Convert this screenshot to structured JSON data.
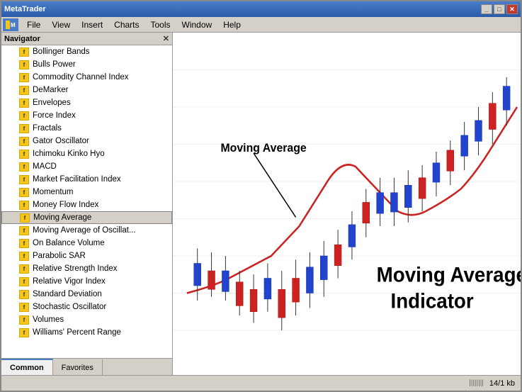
{
  "window": {
    "title": "MetaTrader",
    "title_bar_buttons": [
      "_",
      "□",
      "✕"
    ]
  },
  "menu": {
    "icon_label": "MT",
    "items": [
      "File",
      "View",
      "Insert",
      "Charts",
      "Tools",
      "Window",
      "Help"
    ]
  },
  "navigator": {
    "title": "Navigator",
    "items": [
      "Bollinger Bands",
      "Bulls Power",
      "Commodity Channel Index",
      "DeMarker",
      "Envelopes",
      "Force Index",
      "Fractals",
      "Gator Oscillator",
      "Ichimoku Kinko Hyo",
      "MACD",
      "Market Facilitation Index",
      "Momentum",
      "Money Flow Index",
      "Moving Average",
      "Moving Average of Oscillat...",
      "On Balance Volume",
      "Parabolic SAR",
      "Relative Strength Index",
      "Relative Vigor Index",
      "Standard Deviation",
      "Stochastic Oscillator",
      "Volumes",
      "Williams' Percent Range"
    ],
    "selected_index": 13,
    "tabs": [
      "Common",
      "Favorites"
    ]
  },
  "chart": {
    "moving_average_label": "Moving Average",
    "indicator_label_line1": "Moving Average",
    "indicator_label_line2": "Indicator",
    "background": "#ffffff"
  },
  "status_bar": {
    "bars_indicator": "||||||||",
    "size_info": "14/1 kb"
  }
}
